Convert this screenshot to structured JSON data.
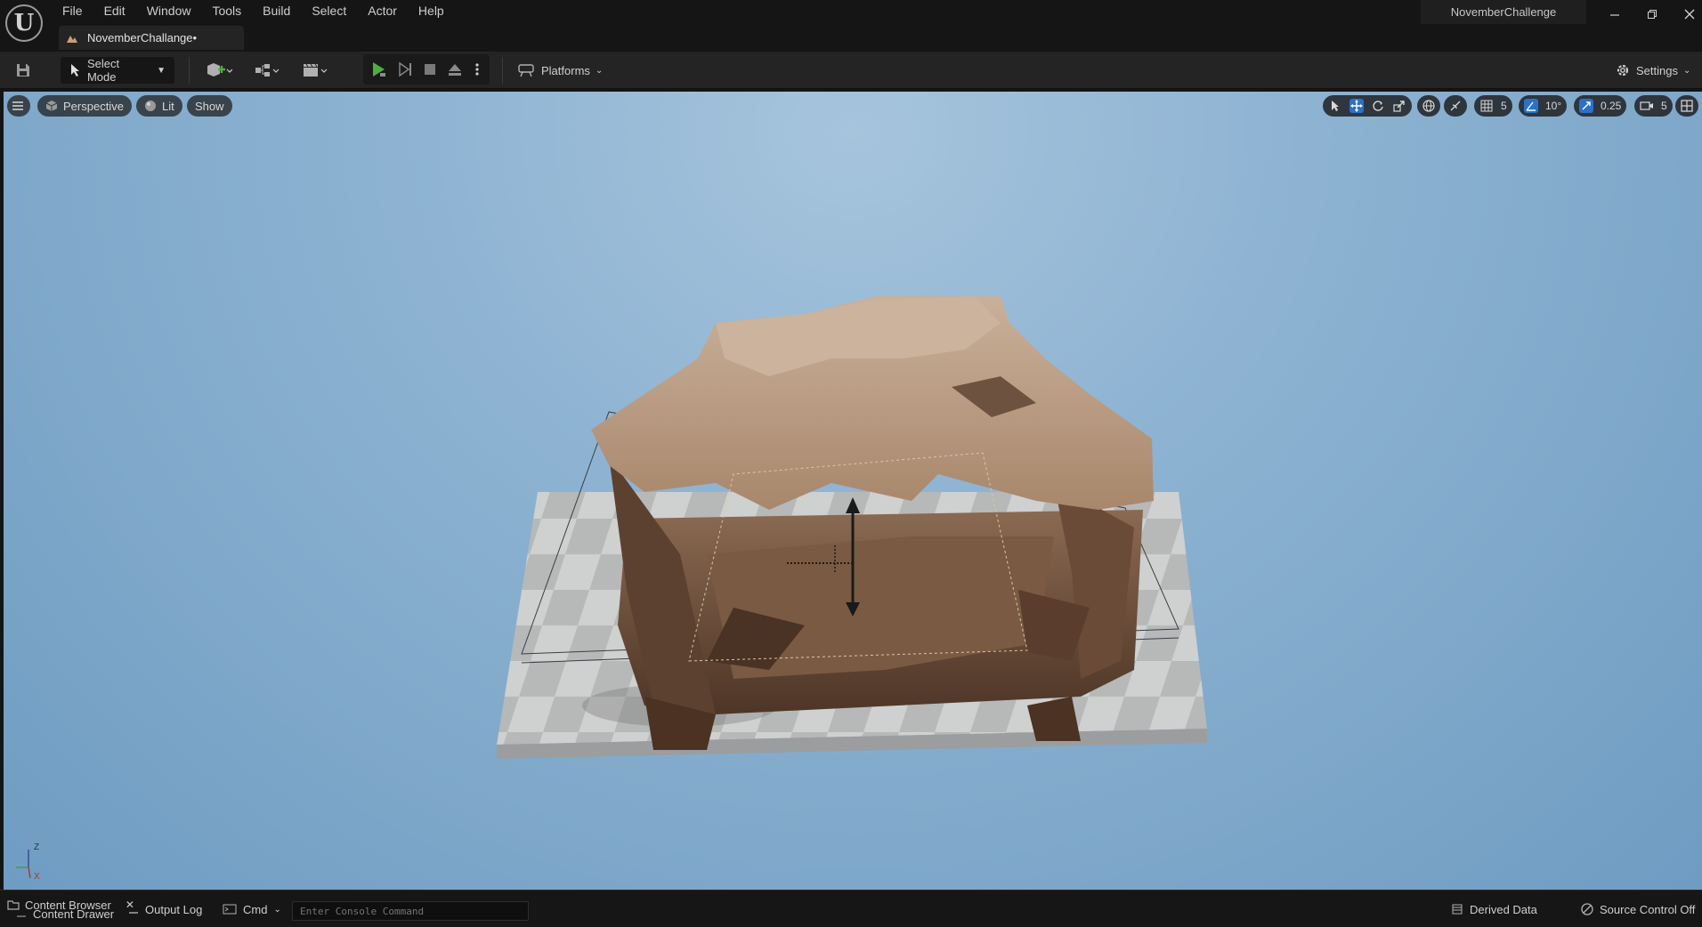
{
  "menu": {
    "items": [
      "File",
      "Edit",
      "Window",
      "Tools",
      "Build",
      "Select",
      "Actor",
      "Help"
    ]
  },
  "document_tab": {
    "label": "NovemberChallange•"
  },
  "project": {
    "name": "NovemberChallenge"
  },
  "toolbar": {
    "select_mode": "Select Mode",
    "platforms": "Platforms",
    "settings": "Settings"
  },
  "viewport": {
    "perspective": "Perspective",
    "lit": "Lit",
    "show": "Show",
    "grid_snap": "5",
    "rotation_snap": "10°",
    "scale_snap": "0.25",
    "camera_speed": "5",
    "axis_z": "Z",
    "axis_x": "X"
  },
  "statusbar": {
    "content_browser": "Content Browser",
    "content_drawer": "Content Drawer",
    "output_log": "Output Log",
    "cmd": "Cmd",
    "console_placeholder": "Enter Console Command",
    "derived_data": "Derived Data",
    "source_control": "Source Control Off"
  },
  "colors": {
    "play_green": "#4caf3e",
    "accent_blue": "#2a72c9",
    "sky_top": "#a6c4dc",
    "sky_bottom": "#6f9cc3",
    "rock": "#8a6d55"
  }
}
